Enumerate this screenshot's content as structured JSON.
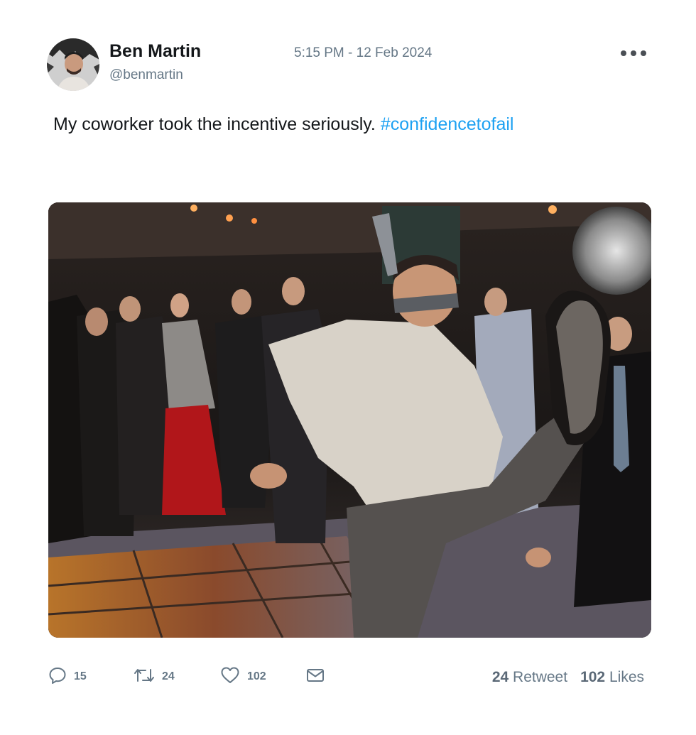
{
  "tweet": {
    "author_name": "Ben Martin",
    "author_handle": "@benmartin",
    "timestamp": "5:15 PM - 12 Feb 2024",
    "more_icon": "more-dots-icon",
    "text": "My coworker took the incentive seriously.",
    "hashtag": "#confidencetofail",
    "colors": {
      "hashtag": "#1da1f2",
      "secondary_text": "#657786",
      "primary_text": "#14171a"
    }
  },
  "actions": {
    "reply": {
      "icon": "reply-icon",
      "count": "15"
    },
    "retweet": {
      "icon": "retweet-icon",
      "count": "24"
    },
    "like": {
      "icon": "heart-icon",
      "count": "102"
    },
    "message": {
      "icon": "envelope-icon"
    }
  },
  "stats": {
    "retweets_count": "24",
    "retweets_label": "Retweet",
    "likes_count": "102",
    "likes_label": "Likes"
  }
}
